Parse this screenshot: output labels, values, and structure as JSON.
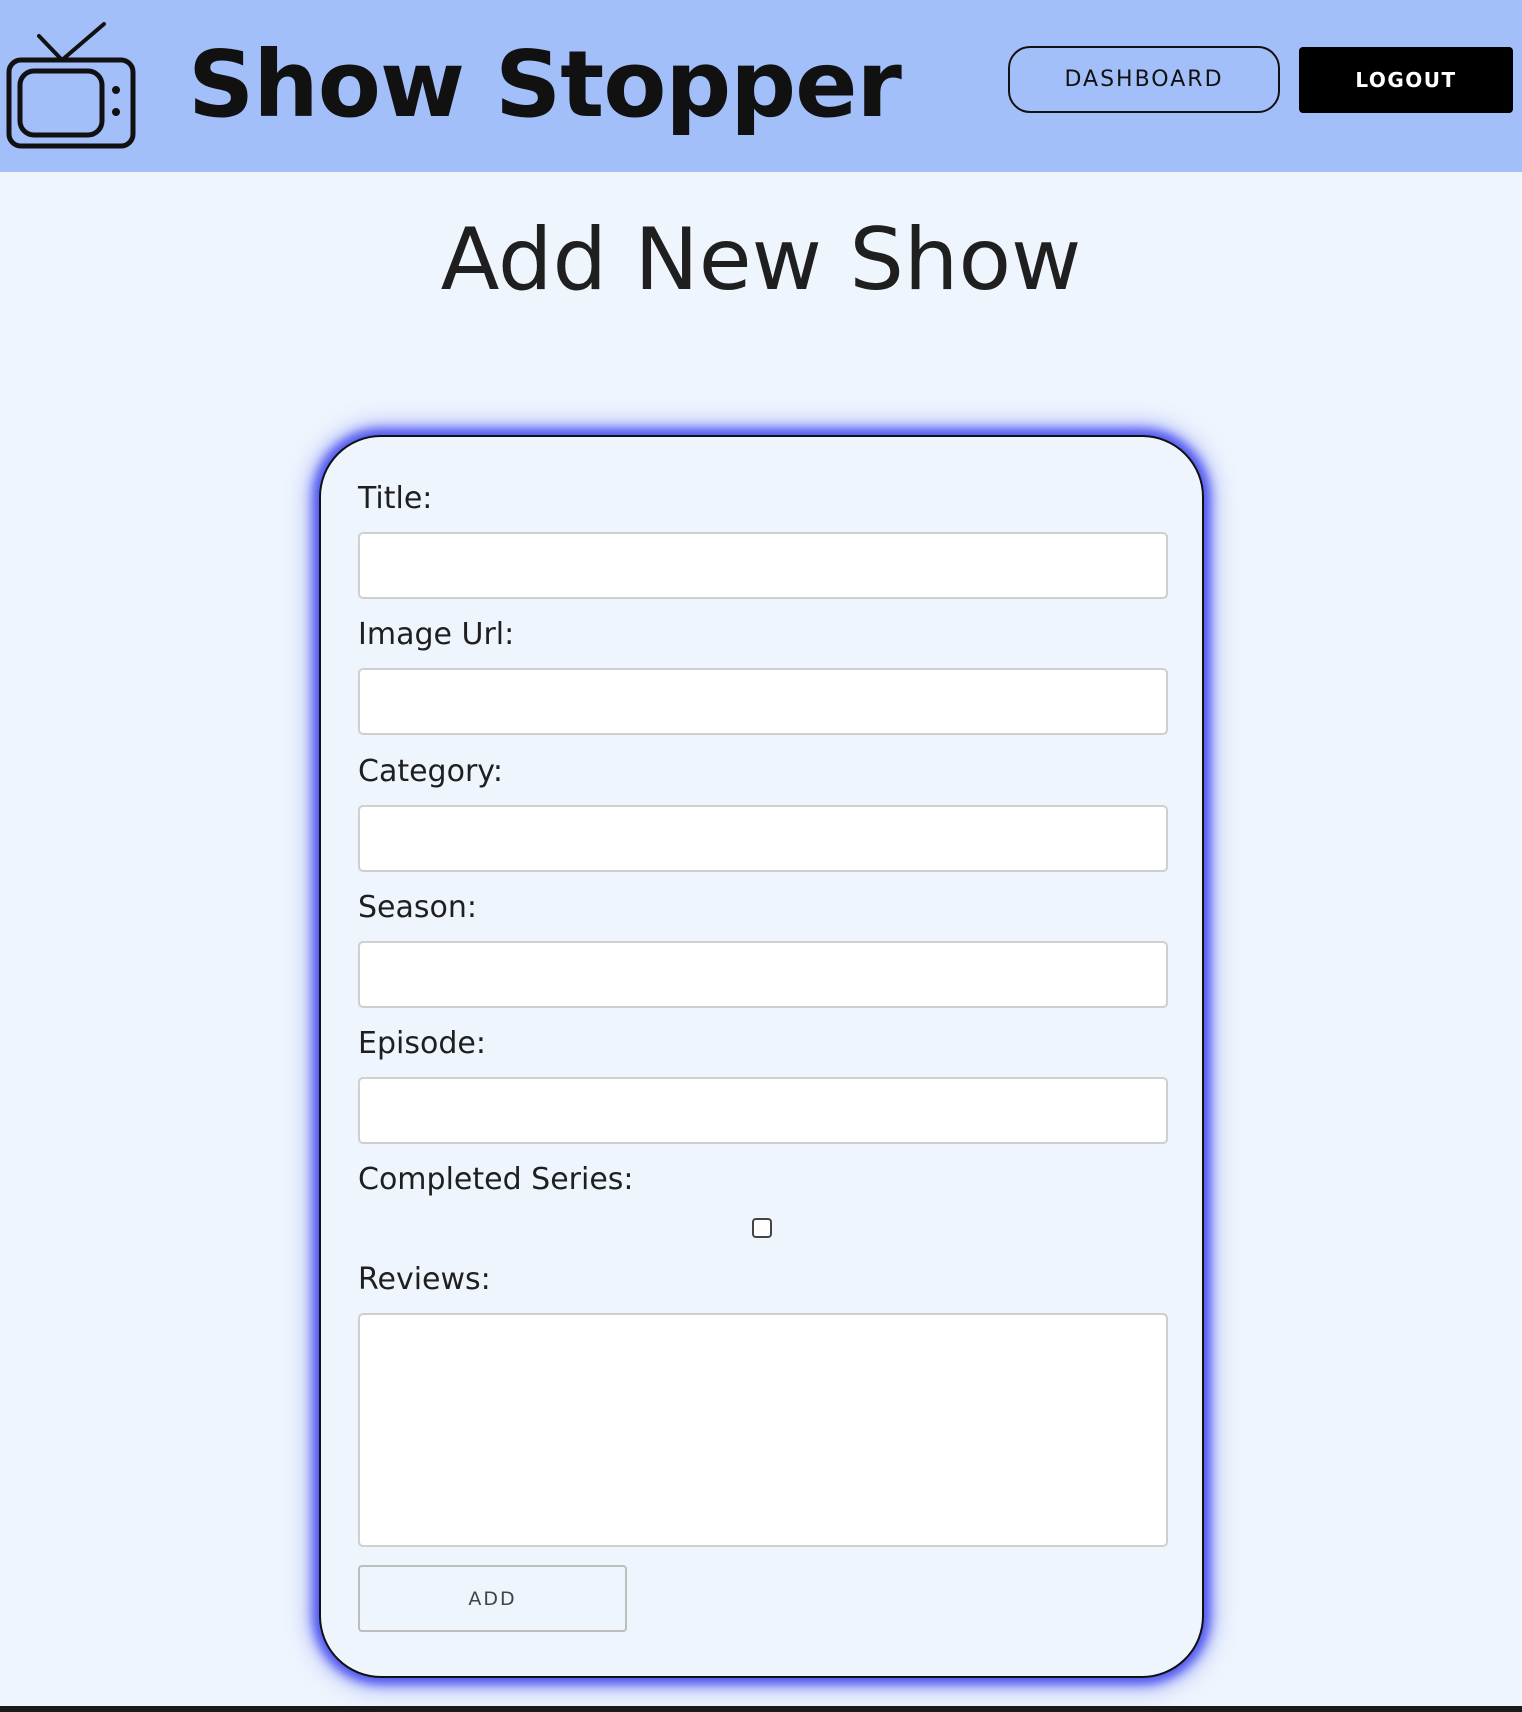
{
  "header": {
    "brand_title": "Show Stopper",
    "logo_icon": "tv-icon",
    "dashboard_label": "DASHBOARD",
    "logout_label": "LOGOUT",
    "background_color": "#a3bff9"
  },
  "page": {
    "heading": "Add New Show",
    "background_color": "#eef5fd"
  },
  "form": {
    "accent_glow_color": "#5057f0",
    "fields": [
      {
        "label": "Title:",
        "value": "",
        "type": "text"
      },
      {
        "label": "Image Url:",
        "value": "",
        "type": "text"
      },
      {
        "label": "Category:",
        "value": "",
        "type": "text"
      },
      {
        "label": "Season:",
        "value": "",
        "type": "text"
      },
      {
        "label": "Episode:",
        "value": "",
        "type": "text"
      }
    ],
    "completed_label": "Completed Series:",
    "completed_checked": false,
    "reviews_label": "Reviews:",
    "reviews_value": "",
    "submit_label": "ADD"
  }
}
